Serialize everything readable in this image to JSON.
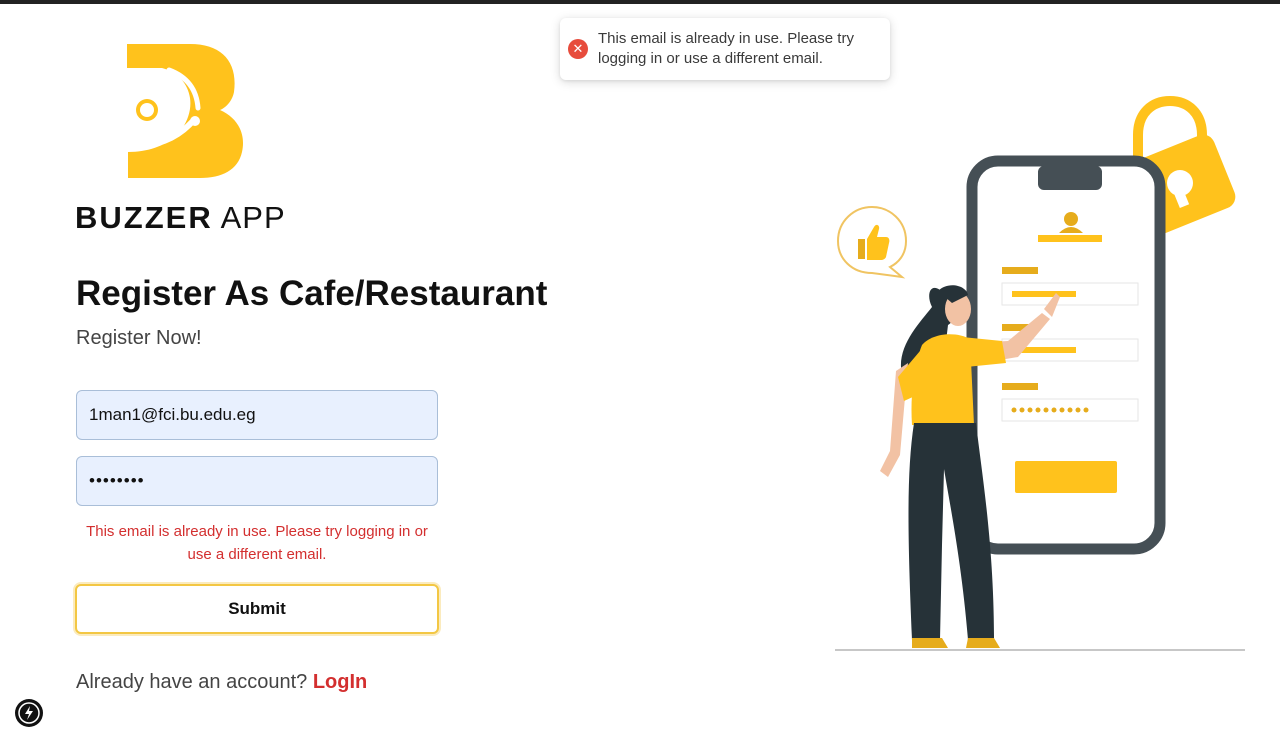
{
  "toast": {
    "icon": "error-icon",
    "message": "This email is already in use. Please try logging in or use a different email."
  },
  "brand": {
    "name_bold": "BUZZER",
    "name_light": "APP",
    "logo": "buzzer-b-logo",
    "color": "#FFC21C"
  },
  "form": {
    "title": "Register As Cafe/Restaurant",
    "subtitle": "Register Now!",
    "email_value": "1man1@fci.bu.edu.eg",
    "password_value": "••••••••",
    "error_message": "This email is already in use. Please try logging in or use a different email.",
    "submit_label": "Submit"
  },
  "footer": {
    "prompt": "Already have an account?",
    "login_label": "LogIn"
  },
  "colors": {
    "accent": "#FFC21C",
    "error": "#D32F2F",
    "input_bg": "#E8F0FE"
  }
}
